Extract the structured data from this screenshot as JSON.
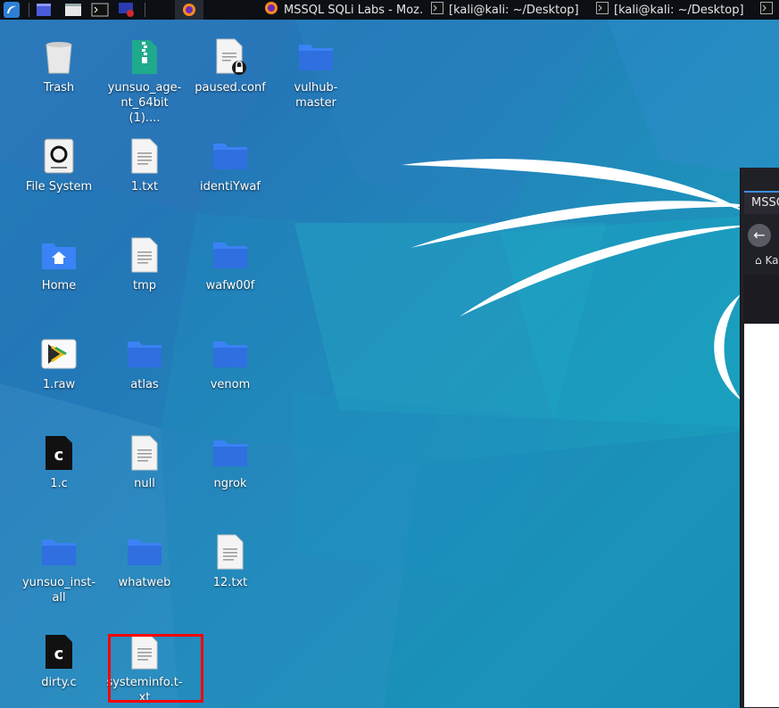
{
  "taskbar": {
    "tasks": [
      {
        "label": "MSSQL SQLi Labs - Moz…",
        "icon": "firefox-icon"
      },
      {
        "label": "[kali@kali: ~/Desktop]",
        "icon": "terminal-icon"
      },
      {
        "label": "[kali@kali: ~/Desktop]",
        "icon": "terminal-icon"
      }
    ]
  },
  "desktop": {
    "icons": [
      {
        "label": "Trash",
        "type": "trash"
      },
      {
        "label": "yunsuo_age-nt_64bit (1)....",
        "type": "archive"
      },
      {
        "label": "paused.conf",
        "type": "locked-file"
      },
      {
        "label": "vulhub-master",
        "type": "folder"
      },
      {
        "label": "File System",
        "type": "drive"
      },
      {
        "label": "1.txt",
        "type": "text"
      },
      {
        "label": "identiYwaf",
        "type": "folder"
      },
      {
        "label": "Home",
        "type": "home"
      },
      {
        "label": "tmp",
        "type": "text"
      },
      {
        "label": "wafw00f",
        "type": "folder"
      },
      {
        "label": "1.raw",
        "type": "raw"
      },
      {
        "label": "atlas",
        "type": "folder"
      },
      {
        "label": "venom",
        "type": "folder"
      },
      {
        "label": "1.c",
        "type": "c"
      },
      {
        "label": "null",
        "type": "text"
      },
      {
        "label": "ngrok",
        "type": "folder"
      },
      {
        "label": "yunsuo_inst-all",
        "type": "folder"
      },
      {
        "label": "whatweb",
        "type": "folder"
      },
      {
        "label": "12.txt",
        "type": "text"
      },
      {
        "label": "dirty.c",
        "type": "c"
      },
      {
        "label": "systeminfo.t-xt",
        "type": "text"
      }
    ]
  },
  "browser": {
    "tab_label": "MSSQL",
    "bookmark_label": "Ka"
  },
  "colors": {
    "highlight": "#ff0000",
    "folder": "#3b82f6",
    "taskbar": "#0c0f14"
  }
}
